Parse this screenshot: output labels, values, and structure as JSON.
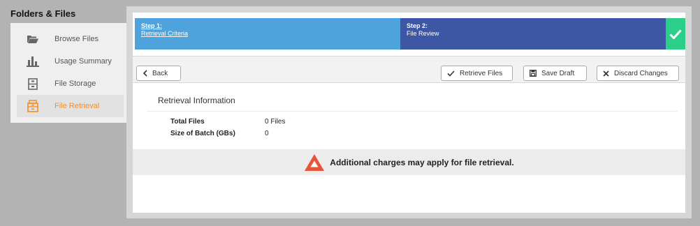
{
  "sidebar": {
    "title": "Folders & Files",
    "items": [
      {
        "label": "Browse Files",
        "icon": "folder-open-icon",
        "active": false
      },
      {
        "label": "Usage Summary",
        "icon": "bar-chart-icon",
        "active": false
      },
      {
        "label": "File Storage",
        "icon": "cabinet-icon",
        "active": false
      },
      {
        "label": "File Retrieval",
        "icon": "archive-box-icon",
        "active": true
      }
    ],
    "active_color": "#f28c28"
  },
  "steps": [
    {
      "title": "Step 1:",
      "subtitle": "Retrieval Criteria",
      "color": "#4ea3dd"
    },
    {
      "title": "Step 2:",
      "subtitle": "File Review",
      "color": "#3d57a5"
    }
  ],
  "step_complete_color": "#2ccf8a",
  "toolbar": {
    "back_label": "Back",
    "retrieve_label": "Retrieve Files",
    "save_draft_label": "Save Draft",
    "discard_label": "Discard Changes"
  },
  "retrieval_info": {
    "title": "Retrieval Information",
    "rows": [
      {
        "label": "Total Files",
        "value": "0 Files"
      },
      {
        "label": "Size of Batch (GBs)",
        "value": "0"
      }
    ]
  },
  "warning": {
    "text": "Additional charges may apply for file retrieval.",
    "icon": "warning-triangle-icon",
    "color": "#e4553a"
  }
}
